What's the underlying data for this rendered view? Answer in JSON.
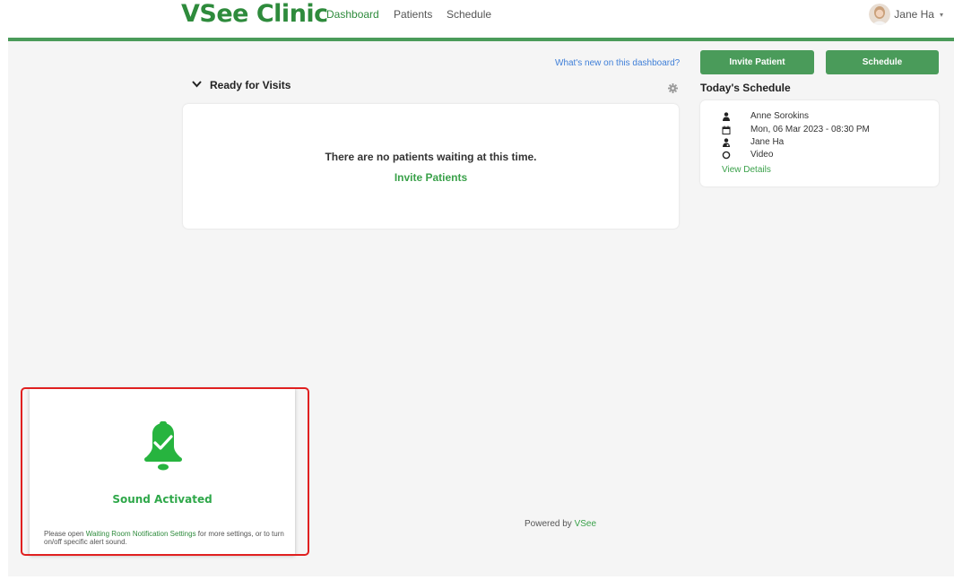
{
  "nav": {
    "logo": "VSee Clinic",
    "links": [
      "Dashboard",
      "Patients",
      "Schedule"
    ],
    "active_link": "Dashboard",
    "user_name": "Jane Ha",
    "user_caret": "▾"
  },
  "toolbar": {
    "whats_new": "What's new on this dashboard?",
    "invite_patient_label": "Invite Patient",
    "schedule_label": "Schedule"
  },
  "ready": {
    "title": "Ready for Visits",
    "empty_message": "There are no patients waiting at this time.",
    "invite_link": "Invite Patients"
  },
  "today": {
    "title": "Today's Schedule",
    "patient": "Anne Sorokins",
    "datetime": "Mon, 06 Mar 2023 - 08:30 PM",
    "provider": "Jane Ha",
    "visit_type": "Video",
    "view_details": "View Details"
  },
  "footer": {
    "powered_prefix": "Powered by ",
    "powered_brand": "VSee"
  },
  "sound_popup": {
    "title": "Sound Activated",
    "note_prefix": "Please open ",
    "note_link": "Waiting Room Notification Settings",
    "note_suffix": " for more settings, or to turn on/off specific alert sound."
  },
  "colors": {
    "brand_green": "#4a9b5a",
    "link_green": "#3aa14a",
    "link_blue": "#3f7fd8",
    "highlight_red": "#e02020"
  }
}
